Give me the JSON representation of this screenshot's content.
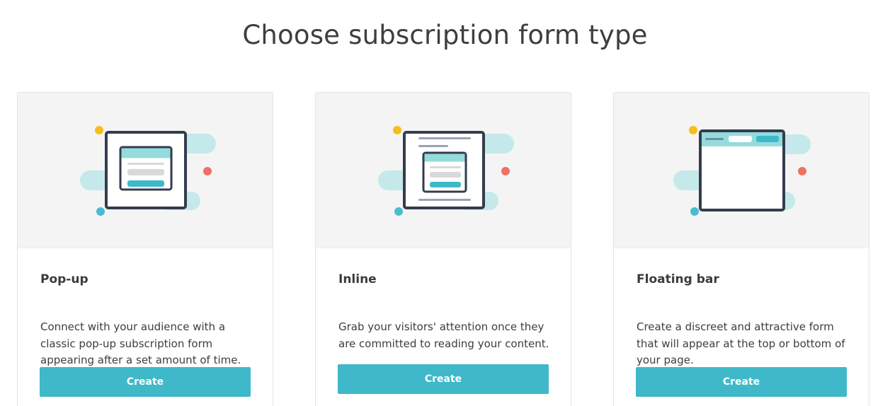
{
  "page": {
    "title": "Choose subscription form type"
  },
  "cards": [
    {
      "title": "Pop-up",
      "description": "Connect with your audience with a classic pop-up subscription form appearing after a set amount of time.",
      "button": "Create",
      "icon": "popup-form-illustration"
    },
    {
      "title": "Inline",
      "description": "Grab your visitors' attention once they are committed to reading your content.",
      "button": "Create",
      "icon": "inline-form-illustration"
    },
    {
      "title": "Floating bar",
      "description": "Create a discreet and attractive form that will appear at the top or bottom of your page.",
      "button": "Create",
      "icon": "floating-bar-illustration"
    }
  ],
  "colors": {
    "accent": "#3fb8c9",
    "dark_frame": "#343c4e",
    "blob": "#c5e9ea",
    "dot_yellow": "#f5bd1e",
    "dot_red": "#f07063",
    "dot_teal": "#4bbcd0"
  }
}
